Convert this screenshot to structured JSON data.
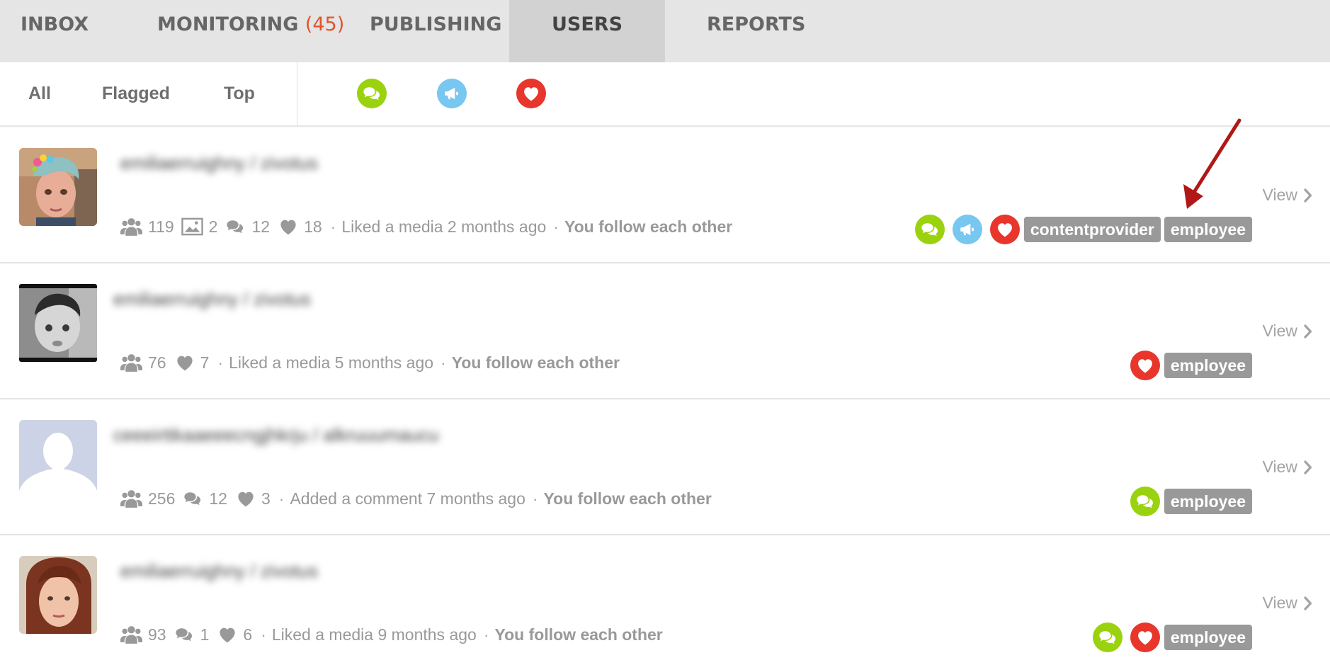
{
  "nav": {
    "tabs": [
      {
        "label": "INBOX"
      },
      {
        "label": "MONITORING",
        "count": "(45)"
      },
      {
        "label": "PUBLISHING"
      },
      {
        "label": "USERS",
        "active": true
      },
      {
        "label": "REPORTS"
      }
    ]
  },
  "filters": {
    "items": [
      {
        "label": "All"
      },
      {
        "label": "Flagged"
      },
      {
        "label": "Top"
      }
    ],
    "icon_filters": [
      "comment-icon",
      "megaphone-icon",
      "heart-icon"
    ]
  },
  "colors": {
    "green": "#9bd20f",
    "blue": "#77c7f0",
    "red": "#e8362c",
    "accent_count": "#e0552a",
    "tag_bg": "#999999"
  },
  "users": [
    {
      "name": "emiliaerruighny / zivotus",
      "followers": "119",
      "media": "2",
      "comments": "12",
      "likes": "18",
      "activity": "Liked a media 2 months ago",
      "relationship": "You follow each other",
      "view_label": "View",
      "badge_icons": [
        "comment-icon",
        "megaphone-icon",
        "heart-icon"
      ],
      "tags": [
        "contentprovider",
        "employee"
      ]
    },
    {
      "name": "emiliaerruighny / zivotus",
      "followers": "76",
      "likes": "7",
      "activity": "Liked a media 5 months ago",
      "relationship": "You follow each other",
      "view_label": "View",
      "badge_icons": [
        "heart-icon"
      ],
      "tags": [
        "employee"
      ]
    },
    {
      "name": "ceeeirttkaaeeecngjhkrju / alkruuumaucu",
      "followers": "256",
      "comments": "12",
      "likes": "3",
      "activity": "Added a comment 7 months ago",
      "relationship": "You follow each other",
      "view_label": "View",
      "badge_icons": [
        "comment-icon"
      ],
      "tags": [
        "employee"
      ]
    },
    {
      "name": "emiliaerruighny / zivotus",
      "followers": "93",
      "comments": "1",
      "likes": "6",
      "activity": "Liked a media 9 months ago",
      "relationship": "You follow each other",
      "view_label": "View",
      "badge_icons": [
        "comment-icon",
        "heart-icon"
      ],
      "tags": [
        "employee"
      ]
    }
  ]
}
